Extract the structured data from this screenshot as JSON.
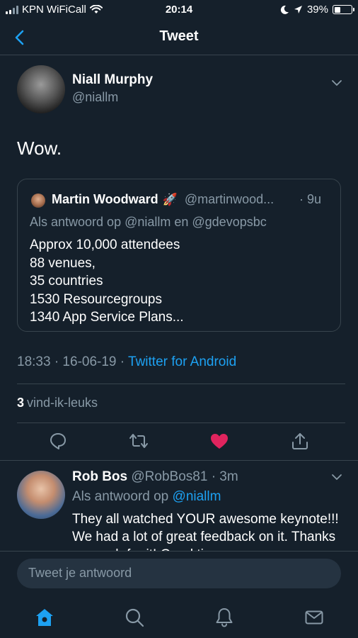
{
  "status_bar": {
    "carrier": "KPN WiFiCall",
    "time": "20:14",
    "battery": "39%",
    "battery_level": 0.39
  },
  "nav": {
    "title": "Tweet",
    "back_icon": "chevron-left-icon"
  },
  "tweet": {
    "author_name": "Niall Murphy",
    "author_handle": "@niallm",
    "text": "Wow.",
    "quoted": {
      "author_name": "Martin Woodward",
      "emoji": "🚀",
      "author_handle": "@martinwood...",
      "time": "· 9u",
      "reply_context": "Als antwoord op @niallm en @gdevopsbc",
      "lines": [
        "Approx 10,000 attendees",
        "88 venues,",
        "35 countries",
        "1530 Resourcegroups",
        "1340 App Service Plans..."
      ]
    },
    "timestamp": "18:33 · 16-06-19 · ",
    "source": "Twitter for Android",
    "like_count": "3",
    "like_label": "vind-ik-leuks",
    "actions": [
      "reply-icon",
      "retweet-icon",
      "heart-icon",
      "share-icon"
    ]
  },
  "reply": {
    "author_name": "Rob Bos",
    "author_handle": "@RobBos81",
    "time": "· 3m",
    "reply_prefix": "Als antwoord op ",
    "reply_mention": "@niallm",
    "text": "They all watched YOUR awesome keynote!!! We had a lot of great feedback on it. Thanks so much for it! Good times"
  },
  "compose": {
    "placeholder": "Tweet je antwoord"
  },
  "tab_bar": {
    "tabs": [
      "home-icon",
      "search-icon",
      "notifications-icon",
      "messages-icon"
    ]
  },
  "colors": {
    "background": "#15202b",
    "accent": "#1da1f2",
    "secondary_text": "#8899a6",
    "like": "#e0245e",
    "divider": "#38444d"
  }
}
